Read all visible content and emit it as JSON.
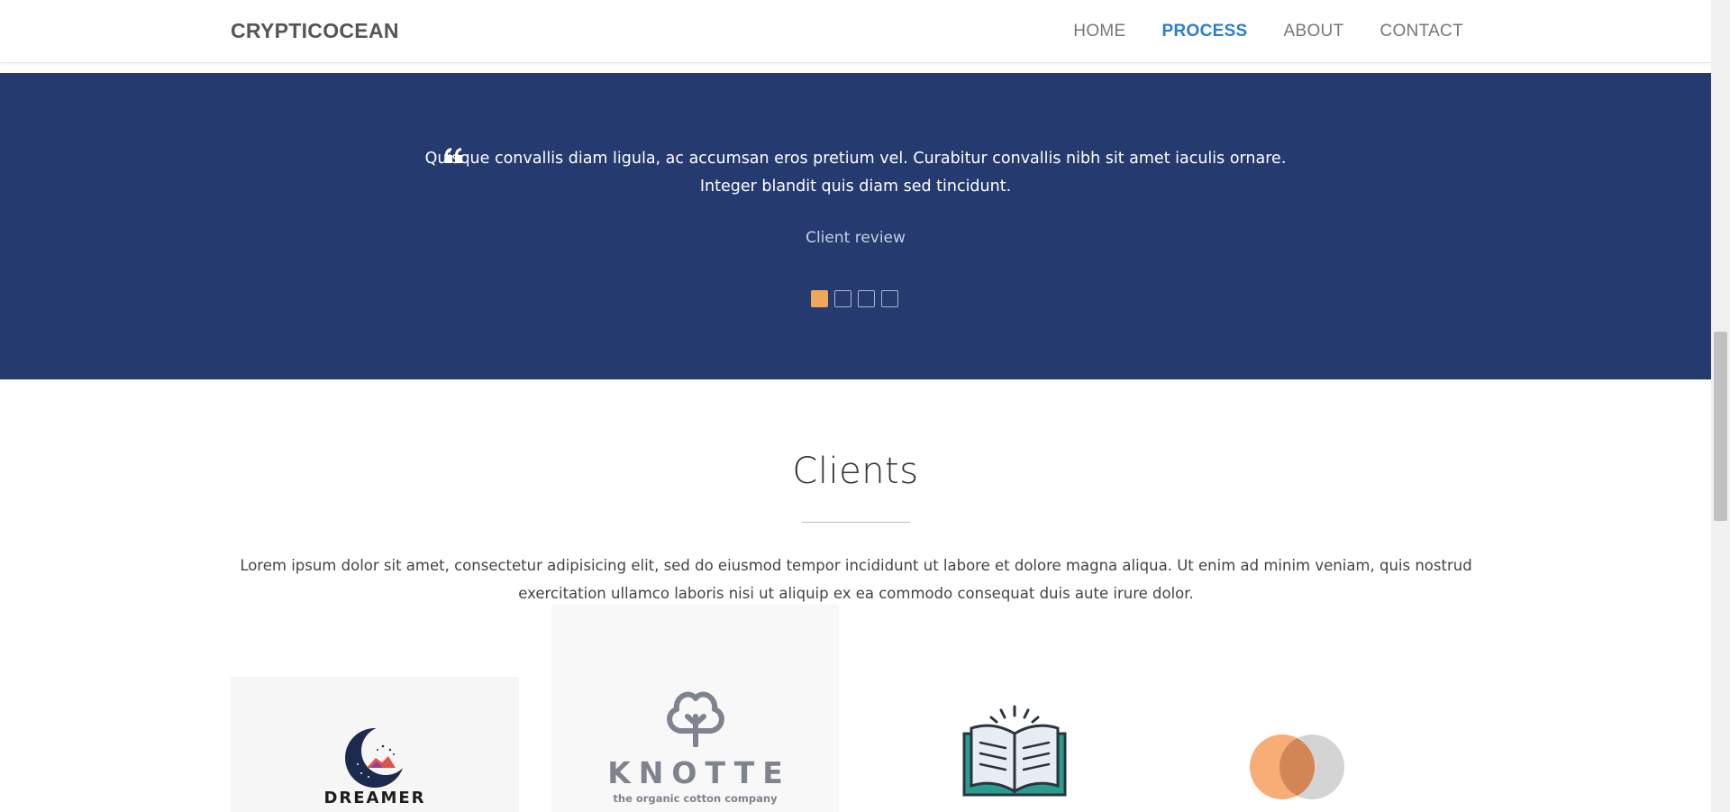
{
  "navbar": {
    "brand": "CRYPTICOCEAN",
    "links": [
      {
        "label": "HOME",
        "active": false
      },
      {
        "label": "PROCESS",
        "active": true
      },
      {
        "label": "ABOUT",
        "active": false
      },
      {
        "label": "CONTACT",
        "active": false
      }
    ]
  },
  "testimonial": {
    "quote_icon": "quote-left-icon",
    "line1": "Quisque convallis diam ligula, ac accumsan eros pretium vel. Curabitur convallis nibh sit amet iaculis ornare.",
    "line2": "Integer blandit quis diam sed tincidunt.",
    "author": "Client review",
    "slides_total": 4,
    "active_slide": 1,
    "band_color": "#253a6e",
    "dot_active_color": "#f0a75a"
  },
  "clients": {
    "title": "Clients",
    "description_line1": "Lorem ipsum dolor sit amet, consectetur adipisicing elit, sed do eiusmod tempor incididunt ut labore et dolore magna aliqua. Ut enim ad minim veniam, quis nostrud",
    "description_line2": "exercitation ullamco laboris nisi ut aliquip ex ea commodo consequat duis aute irure dolor.",
    "logos": [
      {
        "name": "DREAMER",
        "icon": "moon-mountain-icon"
      },
      {
        "name": "KNOTTE",
        "tagline": "the organic cotton company",
        "icon": "cotton-icon"
      },
      {
        "name": "",
        "icon": "open-book-icon"
      },
      {
        "name": "",
        "icon": "overlapping-circles-icon"
      }
    ]
  }
}
